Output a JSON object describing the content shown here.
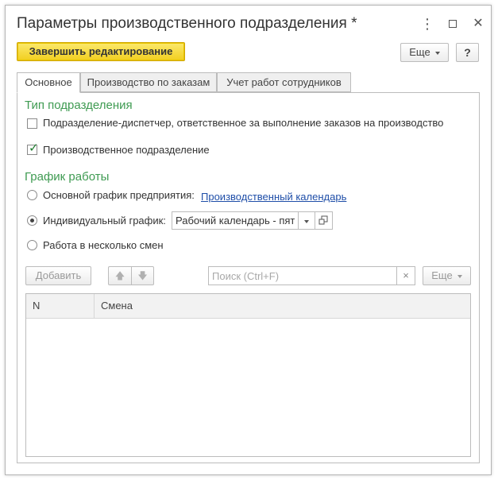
{
  "window": {
    "title": "Параметры производственного подразделения *",
    "more_glyph": "⋮",
    "close_glyph": "✕"
  },
  "toolbar": {
    "finish_label": "Завершить редактирование",
    "more_label": "Еще",
    "help_label": "?"
  },
  "tabs": [
    {
      "label": "Основное",
      "active": true
    },
    {
      "label": "Производство по заказам",
      "active": false
    },
    {
      "label": "Учет работ сотрудников",
      "active": false
    }
  ],
  "division_type": {
    "title": "Тип подразделения",
    "dispatcher": {
      "label": "Подразделение-диспетчер, ответственное за выполнение заказов на производство",
      "checked": false
    },
    "production": {
      "label": "Производственное подразделение",
      "checked": true
    }
  },
  "schedule": {
    "title": "График работы",
    "main": {
      "label": "Основной график предприятия:",
      "link": "Производственный календарь",
      "selected": false
    },
    "individual": {
      "label": "Индивидуальный график:",
      "value": "Рабочий календарь - пятидневка",
      "selected": true
    },
    "shifts": {
      "label": "Работа в несколько смен",
      "selected": false
    }
  },
  "shifts_table": {
    "add_label": "Добавить",
    "up_glyph": "🡅",
    "down_glyph": "🡇",
    "search_placeholder": "Поиск (Ctrl+F)",
    "clear_glyph": "×",
    "more_label": "Еще",
    "columns": [
      "N",
      "Смена"
    ],
    "rows": []
  },
  "colors": {
    "accent_yellow": "#f2cf1f",
    "group_title_green": "#3f9b52",
    "link_blue": "#1f4ea8"
  }
}
